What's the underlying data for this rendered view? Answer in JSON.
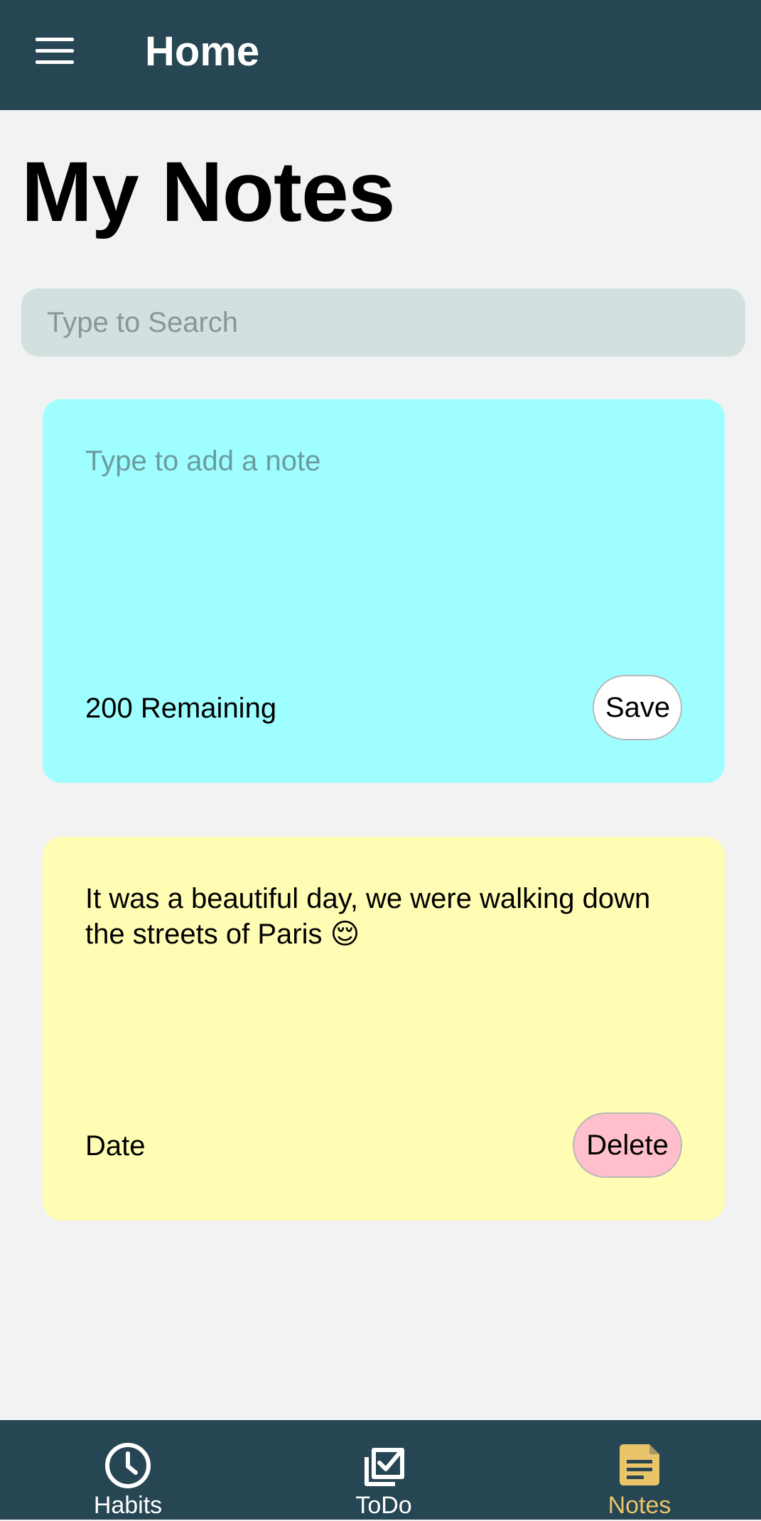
{
  "app_bar": {
    "title": "Home",
    "menu_icon": "hamburger-menu-icon"
  },
  "page": {
    "title": "My Notes"
  },
  "search": {
    "placeholder": "Type to Search",
    "value": ""
  },
  "new_note": {
    "placeholder": "Type to add a note",
    "value": "",
    "remaining_label": "200 Remaining",
    "save_label": "Save",
    "background": "#9ffeff"
  },
  "notes": [
    {
      "text": "It was a beautiful day, we were walking down the streets of Paris 😌",
      "date_label": "Date",
      "delete_label": "Delete",
      "background": "#fefdb3"
    }
  ],
  "bottom_nav": {
    "items": [
      {
        "label": "Habits",
        "icon": "clock-icon",
        "active": false
      },
      {
        "label": "ToDo",
        "icon": "checkbox-icon",
        "active": false
      },
      {
        "label": "Notes",
        "icon": "note-icon",
        "active": true
      }
    ]
  },
  "colors": {
    "app_bar": "#264653",
    "active_tab": "#e9c46a",
    "background": "#f2f2f2",
    "delete_button": "#ffc0cb"
  }
}
